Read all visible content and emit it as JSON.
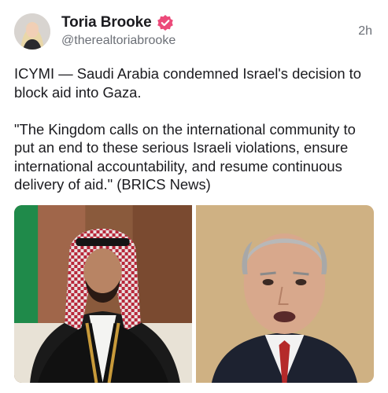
{
  "post": {
    "author": {
      "display_name": "Toria Brooke",
      "handle": "@therealtoriabrooke",
      "verified_badge_icon": "verified-check-icon",
      "avatar_icon": "profile-photo"
    },
    "timestamp": "2h",
    "text": "ICYMI — Saudi Arabia condemned Israel's decision to block aid into Gaza.\n\n\"The Kingdom calls on the international community to put an end to these serious Israeli violations, ensure international accountability, and resume continuous delivery of aid.\" (BRICS News)",
    "media": [
      {
        "icon": "photo-saudi-crown-prince"
      },
      {
        "icon": "photo-netanyahu"
      }
    ],
    "colors": {
      "verified_badge": "#ec4a7a",
      "secondary_text": "#6b6f76"
    }
  }
}
